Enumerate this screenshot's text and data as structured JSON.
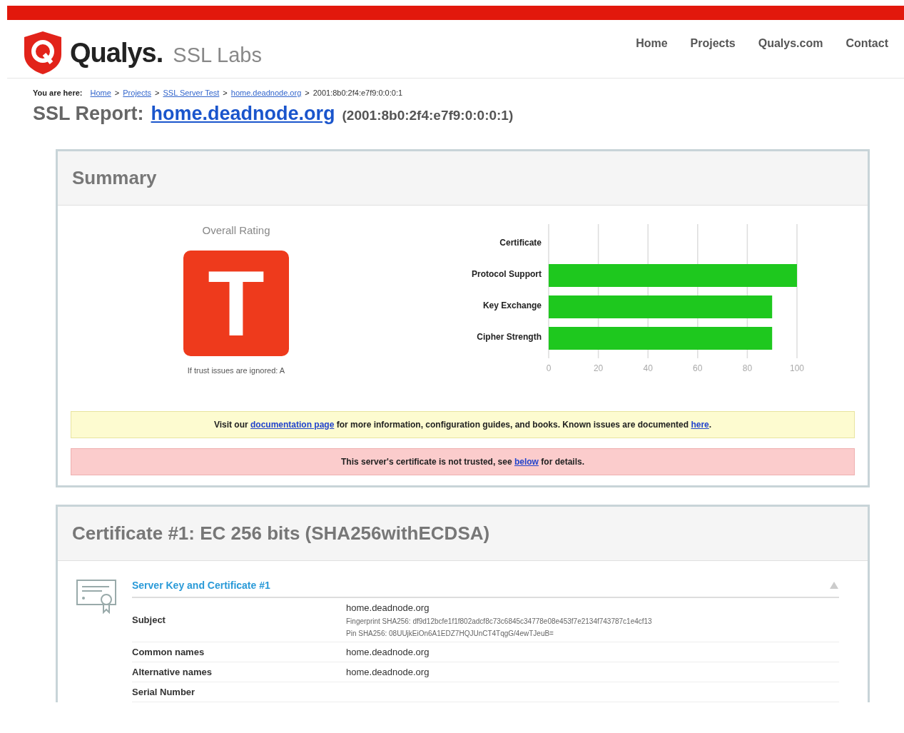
{
  "header": {
    "brand": "Qualys.",
    "product": "SSL Labs",
    "nav": [
      "Home",
      "Projects",
      "Qualys.com",
      "Contact"
    ]
  },
  "breadcrumb": {
    "label": "You are here:",
    "items": [
      {
        "kind": "link",
        "text": "Home"
      },
      {
        "kind": "separator",
        "text": ">"
      },
      {
        "kind": "link",
        "text": "Projects"
      },
      {
        "kind": "separator",
        "text": ">"
      },
      {
        "kind": "link",
        "text": "SSL Server Test"
      },
      {
        "kind": "separator",
        "text": ">"
      },
      {
        "kind": "link",
        "text": "home.deadnode.org"
      },
      {
        "kind": "separator",
        "text": ">"
      },
      {
        "kind": "text",
        "text": "2001:8b0:2f4:e7f9:0:0:0:1"
      }
    ]
  },
  "report": {
    "title": "SSL Report:",
    "host": "home.deadnode.org",
    "address": "(2001:8b0:2f4:e7f9:0:0:0:1)"
  },
  "summary": {
    "title": "Summary",
    "rating_label": "Overall Rating",
    "grade": "T",
    "note": "If trust issues are ignored: A",
    "chart_data": {
      "type": "bar",
      "orientation": "horizontal",
      "categories": [
        "Certificate",
        "Protocol Support",
        "Key Exchange",
        "Cipher Strength"
      ],
      "values": [
        0,
        100,
        90,
        90
      ],
      "xlim": [
        0,
        100
      ],
      "xticks": [
        0,
        20,
        40,
        60,
        80,
        100
      ],
      "grid": true
    },
    "notices": [
      {
        "kind": "info",
        "parts": [
          {
            "kind": "text",
            "text": "Visit our "
          },
          {
            "kind": "link",
            "text": "documentation page"
          },
          {
            "kind": "text",
            "text": " for more information, configuration guides, and books. Known issues are documented "
          },
          {
            "kind": "link",
            "text": "here"
          },
          {
            "kind": "text",
            "text": "."
          }
        ]
      },
      {
        "kind": "error",
        "parts": [
          {
            "kind": "text",
            "text": "This server's certificate is not trusted, see "
          },
          {
            "kind": "link",
            "text": "below"
          },
          {
            "kind": "text",
            "text": " for details."
          }
        ]
      }
    ]
  },
  "certificate": {
    "title": "Certificate #1: EC 256 bits (SHA256withECDSA)",
    "section": "Server Key and Certificate #1",
    "rows": [
      {
        "label": "Subject",
        "values": [
          "home.deadnode.org",
          "Fingerprint SHA256: df9d12bcfe1f1f802adcf8c73c6845c34778e08e453f7e2134f743787c1e4cf13",
          "Pin SHA256: 08UUjkEiOn6A1EDZ7HQJUnCT4TqgG/4ewTJeuB="
        ]
      },
      {
        "label": "Common names",
        "values": [
          "home.deadnode.org"
        ]
      },
      {
        "label": "Alternative names",
        "values": [
          "home.deadnode.org"
        ]
      },
      {
        "label": "Serial Number",
        "values": []
      }
    ]
  }
}
